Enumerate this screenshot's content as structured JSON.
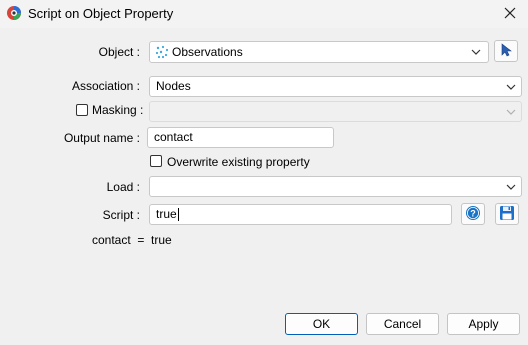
{
  "window": {
    "title": "Script on Object Property"
  },
  "form": {
    "object": {
      "label": "Object :",
      "value": "Observations"
    },
    "association": {
      "label": "Association :",
      "value": "Nodes"
    },
    "masking": {
      "label": "Masking :",
      "value": ""
    },
    "output_name": {
      "label": "Output name :",
      "value": "contact"
    },
    "overwrite": {
      "label": "Overwrite existing property",
      "checked": false
    },
    "load": {
      "label": "Load :",
      "value": ""
    },
    "script": {
      "label": "Script :",
      "value": "true"
    },
    "result": {
      "text": "contact  =  true"
    }
  },
  "buttons": {
    "ok": "OK",
    "cancel": "Cancel",
    "apply": "Apply"
  },
  "icons": [
    "app-logo-icon",
    "close-icon",
    "points-icon",
    "chevron-down-icon",
    "cursor-pick-icon",
    "help-icon",
    "save-icon"
  ],
  "colors": {
    "accent": "#005fb8",
    "help_blue": "#1a73c7"
  }
}
